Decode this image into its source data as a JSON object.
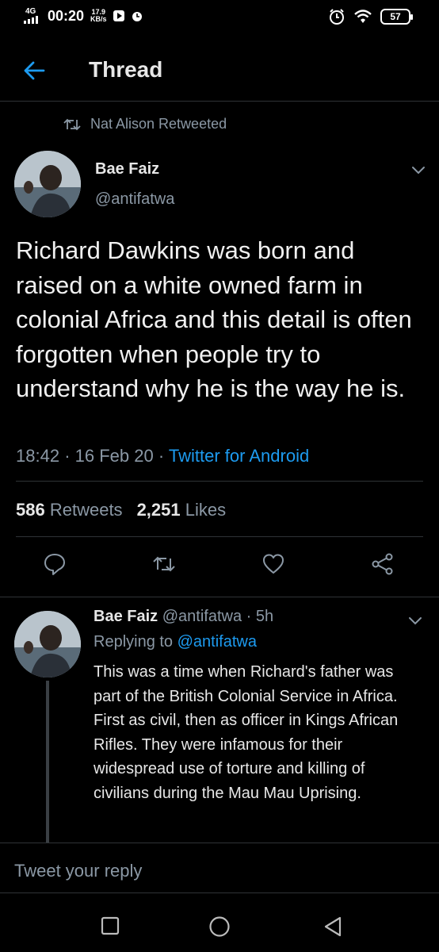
{
  "status_bar": {
    "network": "4G",
    "time": "00:20",
    "speed_value": "17.9",
    "speed_unit": "KB/s",
    "battery": "57"
  },
  "header": {
    "title": "Thread"
  },
  "retweet": {
    "label": "Nat Alison Retweeted"
  },
  "tweet": {
    "name": "Bae Faiz",
    "handle": "@antifatwa",
    "text": "Richard Dawkins was born and raised on a white owned farm in colonial Africa and this detail is often forgotten when people try to understand why he is the way he is.",
    "time": "18:42",
    "date": "16 Feb 20",
    "source": "Twitter for Android",
    "retweets_count": "586",
    "retweets_label": "Retweets",
    "likes_count": "2,251",
    "likes_label": "Likes"
  },
  "reply": {
    "name": "Bae Faiz",
    "handle": "@antifatwa",
    "age": "5h",
    "replying_prefix": "Replying to",
    "replying_handle": "@antifatwa",
    "text": "This was a time when Richard's father was part of the British Colonial Service in Africa. First as civil, then as officer in Kings African Rifles. They were infamous for their widespread use of torture and killing of civilians during the Mau Mau Uprising."
  },
  "reply_bar": {
    "placeholder": "Tweet your reply"
  }
}
